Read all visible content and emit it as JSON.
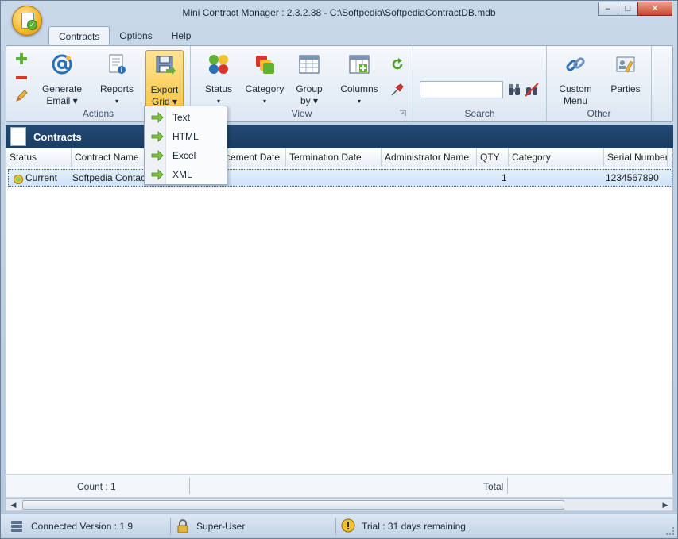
{
  "window": {
    "title": "Mini Contract Manager : 2.3.2.38 - C:\\Softpedia\\SoftpediaContractDB.mdb",
    "minimize": "–",
    "maximize": "□",
    "close": "✕"
  },
  "tabs": [
    {
      "label": "Contracts",
      "active": true
    },
    {
      "label": "Options",
      "active": false
    },
    {
      "label": "Help",
      "active": false
    }
  ],
  "ribbon": {
    "actions": {
      "label": "Actions",
      "generate_email": {
        "line1": "Generate",
        "line2": "Email ▾"
      },
      "reports": {
        "line1": "Reports",
        "line2": "▾"
      },
      "export_grid": {
        "line1": "Export",
        "line2": "Grid ▾"
      }
    },
    "view": {
      "label": "View",
      "status": {
        "line1": "Status",
        "line2": "▾"
      },
      "category": {
        "line1": "Category",
        "line2": "▾"
      },
      "group_by": {
        "line1": "Group",
        "line2": "by ▾"
      },
      "columns": {
        "line1": "Columns",
        "line2": "▾"
      }
    },
    "search": {
      "label": "Search",
      "placeholder": ""
    },
    "other": {
      "label": "Other",
      "custom_menu": {
        "line1": "Custom",
        "line2": "Menu"
      },
      "parties": {
        "line1": "Parties"
      }
    }
  },
  "export_menu": {
    "items": [
      "Text",
      "HTML",
      "Excel",
      "XML"
    ]
  },
  "panel": {
    "title": "Contracts"
  },
  "grid": {
    "columns": [
      "Status",
      "Contract Name",
      "",
      "...cement Date",
      "Termination Date",
      "Administrator Name",
      "QTY",
      "Category",
      "Serial Number",
      "R"
    ],
    "rows": [
      {
        "status": "Current",
        "contract_name": "Softpedia Contact",
        "qty": "1",
        "serial_number": "1234567890"
      }
    ]
  },
  "footer": {
    "count": "Count : 1",
    "total": "Total"
  },
  "statusbar": {
    "connection": "Connected Version : 1.9",
    "user": "Super-User",
    "trial": "Trial : 31 days remaining."
  },
  "colors": {
    "panel_header": "#1b3c62",
    "pressed_button": "#fbc84a",
    "row_selected": "#cfe2f7"
  }
}
